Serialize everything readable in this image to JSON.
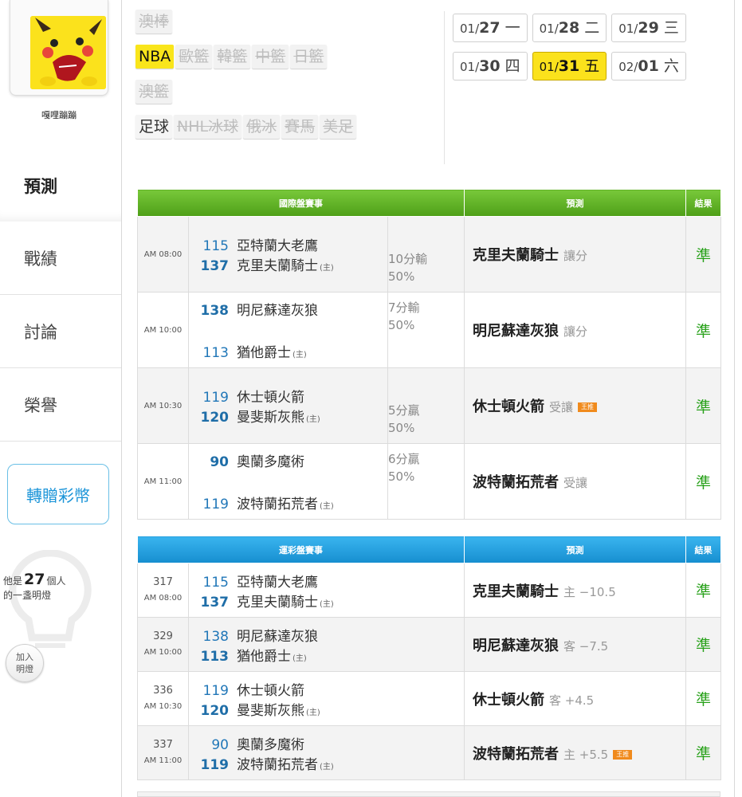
{
  "user": {
    "name": "嘎哩蹦蹦"
  },
  "sidebar": {
    "tabs": [
      "預測",
      "戰績",
      "討論",
      "榮譽"
    ],
    "gift_button": "轉贈彩幣",
    "lamp_prefix": "他是",
    "lamp_count": "27",
    "lamp_suffix": "個人",
    "lamp_line2": "的一盞明燈",
    "join_line1": "加入",
    "join_line2": "明燈"
  },
  "filters": {
    "row1": [
      {
        "label": "澳棒",
        "style": "strike"
      }
    ],
    "row2": [
      {
        "label": "NBA",
        "style": "sel"
      },
      {
        "label": "歐籃",
        "style": "strike"
      },
      {
        "label": "韓籃",
        "style": "strike"
      },
      {
        "label": "中籃",
        "style": "strike"
      },
      {
        "label": "日籃",
        "style": "strike"
      }
    ],
    "row3": [
      {
        "label": "澳籃",
        "style": "strike"
      }
    ],
    "row4": [
      {
        "label": "足球",
        "style": "dark"
      },
      {
        "label": "NHL冰球",
        "style": "strike"
      },
      {
        "label": "俄冰",
        "style": "strike"
      },
      {
        "label": "賽馬",
        "style": "strike"
      },
      {
        "label": "美足",
        "style": "strike"
      }
    ]
  },
  "dates": [
    {
      "md": "01/",
      "d": "27",
      "w": "一",
      "sel": false
    },
    {
      "md": "01/",
      "d": "28",
      "w": "二",
      "sel": false
    },
    {
      "md": "01/",
      "d": "29",
      "w": "三",
      "sel": false
    },
    {
      "md": "01/",
      "d": "30",
      "w": "四",
      "sel": false
    },
    {
      "md": "01/",
      "d": "31",
      "w": "五",
      "sel": true
    },
    {
      "md": "02/",
      "d": "01",
      "w": "六",
      "sel": false
    }
  ],
  "intl": {
    "header": {
      "match": "國際盤賽事",
      "pred": "預測",
      "result": "結果"
    },
    "rows": [
      {
        "time": "AM 08:00",
        "away_num": "115",
        "away": "亞特蘭大老鷹",
        "home_num": "137",
        "home": "克里夫蘭騎士",
        "odds1": "10分輸",
        "odds2": "50%",
        "pred": "克里夫蘭騎士",
        "pred_sub": "讓分",
        "badge": "",
        "result": "準",
        "layout": "tight"
      },
      {
        "time": "AM 10:00",
        "away_num": "138",
        "away": "明尼蘇達灰狼",
        "home_num": "113",
        "home": "猶他爵士",
        "odds1": "7分輸",
        "odds2": "50%",
        "pred": "明尼蘇達灰狼",
        "pred_sub": "讓分",
        "badge": "",
        "result": "準",
        "layout": "split"
      },
      {
        "time": "AM 10:30",
        "away_num": "119",
        "away": "休士頓火箭",
        "home_num": "120",
        "home": "曼斐斯灰熊",
        "odds1": "5分贏",
        "odds2": "50%",
        "pred": "休士頓火箭",
        "pred_sub": "受讓",
        "badge": "王推",
        "result": "準",
        "layout": "tight"
      },
      {
        "time": "AM 11:00",
        "away_num": "90",
        "away": "奧蘭多魔術",
        "home_num": "119",
        "home": "波特蘭拓荒者",
        "odds1": "6分贏",
        "odds2": "50%",
        "pred": "波特蘭拓荒者",
        "pred_sub": "受讓",
        "badge": "",
        "result": "準",
        "layout": "split"
      }
    ]
  },
  "lottery": {
    "header": {
      "match": "運彩盤賽事",
      "pred": "預測",
      "result": "結果"
    },
    "rows": [
      {
        "gid": "317",
        "time": "AM 08:00",
        "away_num": "115",
        "away": "亞特蘭大老鷹",
        "home_num": "137",
        "home": "克里夫蘭騎士",
        "pred": "克里夫蘭騎士",
        "pred_sub": "主 −10.5",
        "badge": "",
        "result": "準"
      },
      {
        "gid": "329",
        "time": "AM 10:00",
        "away_num": "138",
        "away": "明尼蘇達灰狼",
        "home_num": "113",
        "home": "猶他爵士",
        "pred": "明尼蘇達灰狼",
        "pred_sub": "客 −7.5",
        "badge": "",
        "result": "準"
      },
      {
        "gid": "336",
        "time": "AM 10:30",
        "away_num": "119",
        "away": "休士頓火箭",
        "home_num": "120",
        "home": "曼斐斯灰熊",
        "pred": "休士頓火箭",
        "pred_sub": "客 +4.5",
        "badge": "",
        "result": "準"
      },
      {
        "gid": "337",
        "time": "AM 11:00",
        "away_num": "90",
        "away": "奧蘭多魔術",
        "home_num": "119",
        "home": "波特蘭拓荒者",
        "pred": "波特蘭拓荒者",
        "pred_sub": "主 +5.5",
        "badge": "王推",
        "result": "準"
      }
    ]
  },
  "host_mark": "(主)",
  "colors": {
    "accent_green": "#4e9f17",
    "accent_blue": "#168ecf",
    "selected": "#f9e51b",
    "result_green": "#2aa21c"
  }
}
